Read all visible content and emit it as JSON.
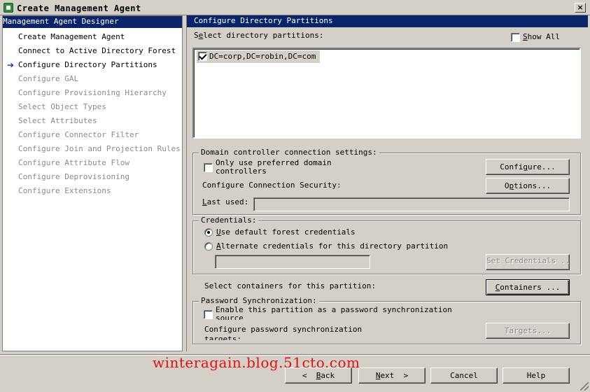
{
  "window": {
    "title": "Create Management Agent",
    "close_glyph": "×"
  },
  "left_pane": {
    "header": "Management Agent Designer",
    "items": [
      {
        "label": "Create Management Agent",
        "enabled": true
      },
      {
        "label": "Connect to Active Directory Forest",
        "enabled": true
      },
      {
        "label": "Configure Directory Partitions",
        "enabled": true,
        "current": true
      },
      {
        "label": "Configure GAL",
        "enabled": false
      },
      {
        "label": "Configure Provisioning Hierarchy",
        "enabled": false
      },
      {
        "label": "Select Object Types",
        "enabled": false
      },
      {
        "label": "Select Attributes",
        "enabled": false
      },
      {
        "label": "Configure Connector Filter",
        "enabled": false
      },
      {
        "label": "Configure Join and Projection Rules",
        "enabled": false
      },
      {
        "label": "Configure Attribute Flow",
        "enabled": false
      },
      {
        "label": "Configure Deprovisioning",
        "enabled": false
      },
      {
        "label": "Configure Extensions",
        "enabled": false
      }
    ],
    "current_marker": "➔"
  },
  "right_pane": {
    "header": "Configure Directory Partitions",
    "select_label_pre": "S",
    "select_label_ul": "e",
    "select_label_post": "lect directory partitions:",
    "show_all": {
      "ul": "S",
      "rest": "how All",
      "checked": false
    },
    "partitions": [
      {
        "label": "DC=corp,DC=robin,DC=com",
        "checked": true
      }
    ],
    "dc_group": {
      "title": "Domain controller connection settings:",
      "preferred_line1": "Only use preferred domain",
      "preferred_line2": "controllers",
      "preferred_checked": false,
      "configure_btn_pre": "Confi",
      "configure_btn_ul": "g",
      "configure_btn_post": "ure...",
      "security_label": "Configure Connection Security:",
      "options_btn_pre": "O",
      "options_btn_ul": "p",
      "options_btn_post": "tions...",
      "last_used_ul": "L",
      "last_used_rest": "ast used:",
      "last_used_value": ""
    },
    "cred_group": {
      "title": "Credentials:",
      "default_ul": "U",
      "default_rest": "se default forest credentials",
      "alternate_ul": "A",
      "alternate_rest": "lternate credentials for this directory partition",
      "default_selected": true,
      "alternate_value": "",
      "set_credentials_btn": "Set Credentials ..."
    },
    "containers": {
      "label": "Select containers for this partition:",
      "button_ul": "C",
      "button_rest": "ontainers ..."
    },
    "pwd_group": {
      "title": "Password Synchronization:",
      "enable_line1": "Enable this partition as a password synchronization",
      "enable_line2": "source",
      "enable_checked": false,
      "targets_label_line1": "Configure password synchronization",
      "targets_label_line2": "targets:",
      "targets_btn": "Targets..."
    }
  },
  "footer": {
    "watermark": "winteragain.blog.51cto.com",
    "back_ul": "B",
    "back_rest": "ack",
    "back_glyph": "<",
    "next_ul": "N",
    "next_rest": "ext",
    "next_glyph": ">",
    "cancel": "Cancel",
    "help": "Help"
  }
}
